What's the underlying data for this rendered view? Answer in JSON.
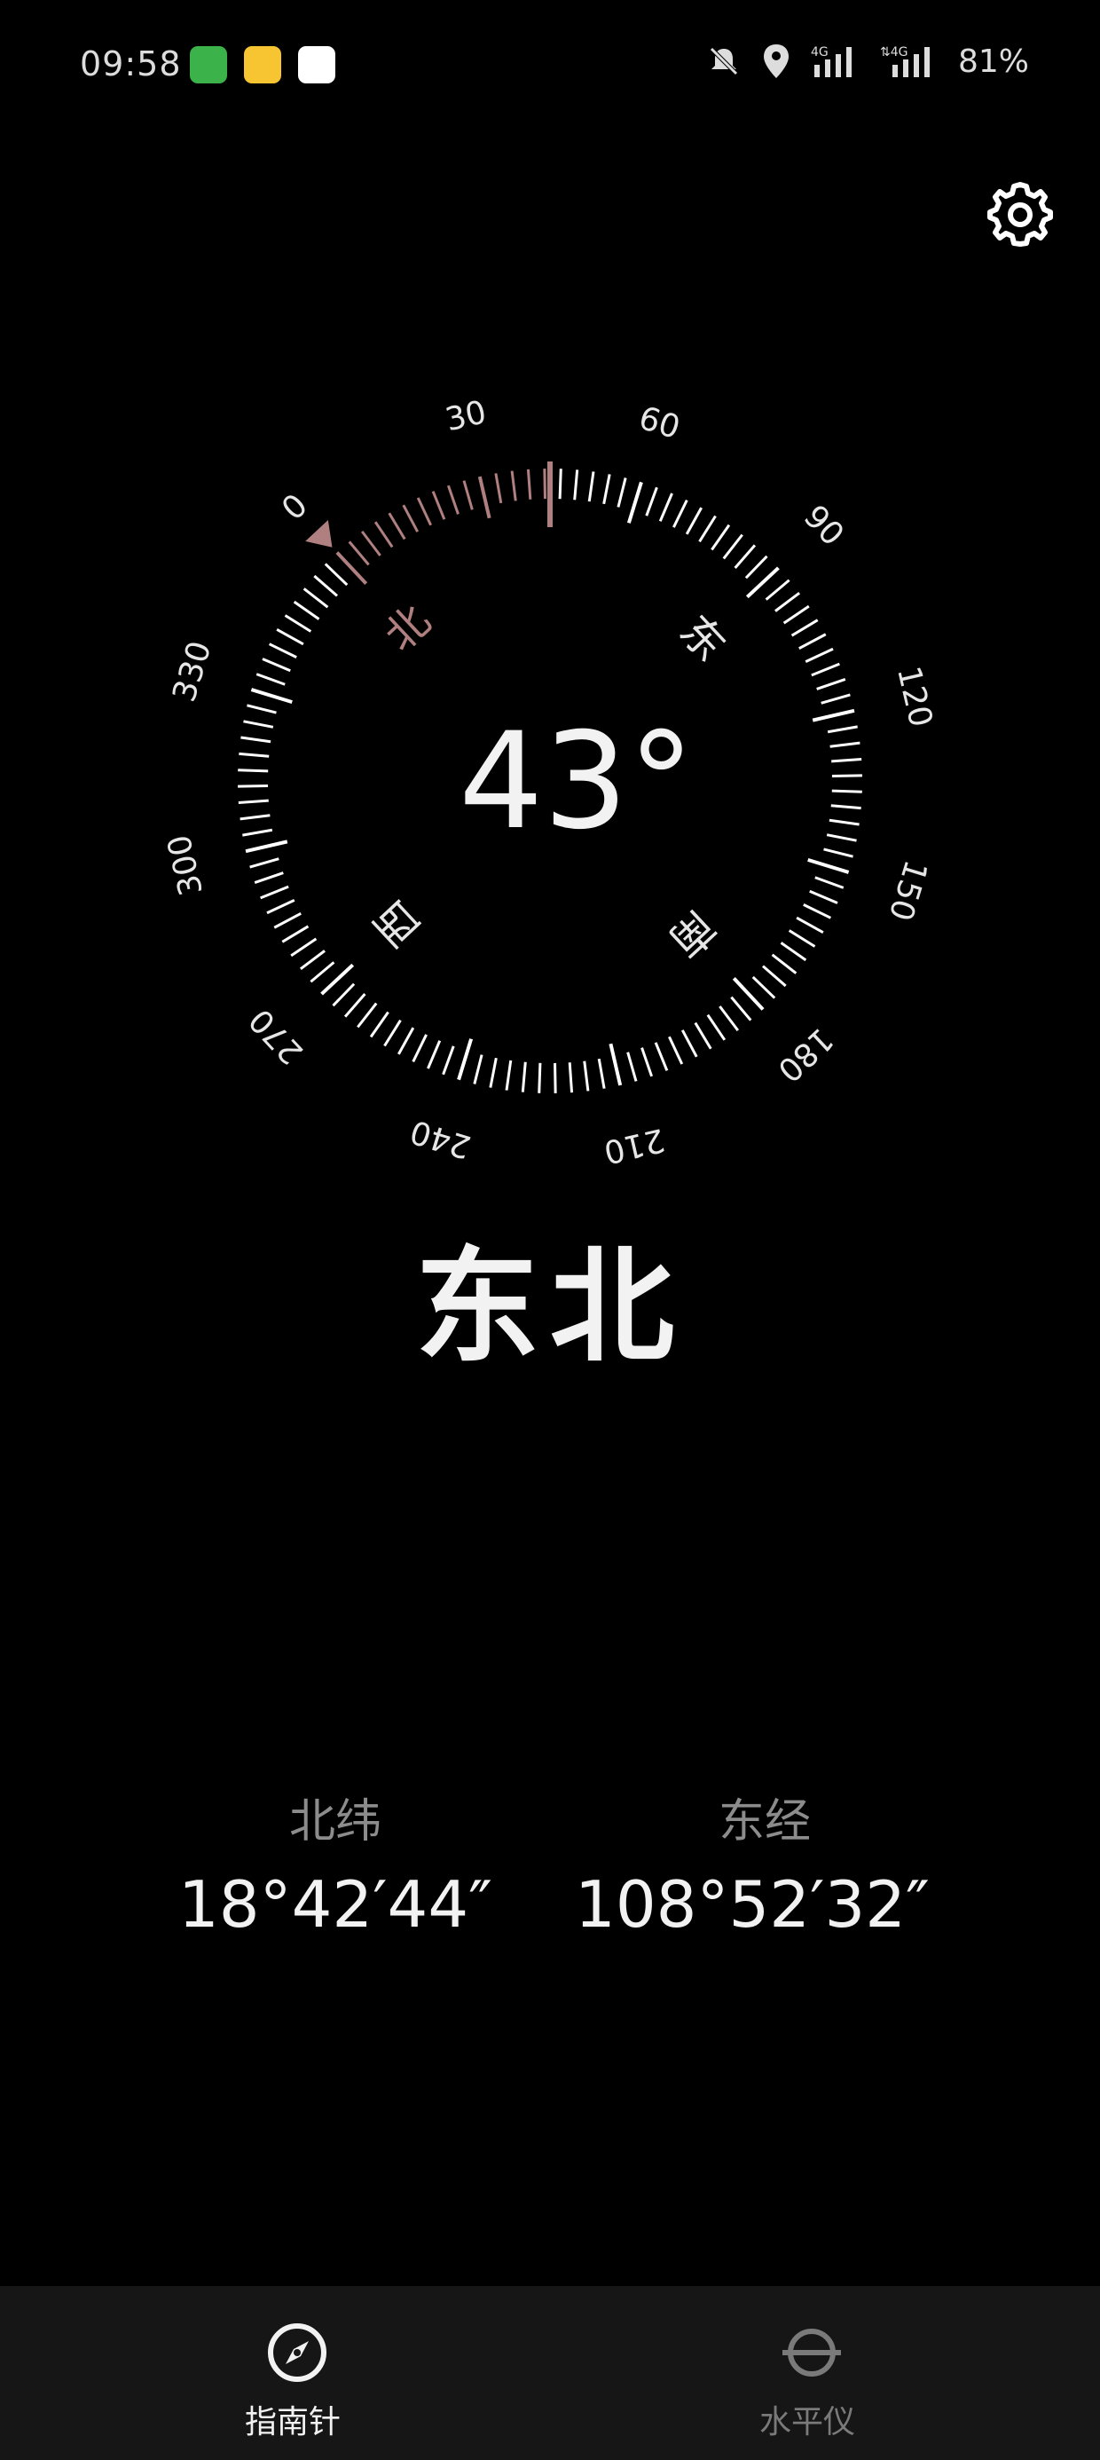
{
  "status_bar": {
    "time": "09:58",
    "apps": [
      "wechat-like-app-icon",
      "weibo-icon",
      "maps-icon"
    ],
    "icons": [
      "mute-icon",
      "location-icon",
      "signal-4g-icon",
      "signal-4g-icon"
    ],
    "battery": "81%"
  },
  "settings": {
    "icon": "gear-icon"
  },
  "compass": {
    "heading_text": "43°",
    "heading_degrees": 43,
    "degree_labels": [
      "0",
      "30",
      "60",
      "90",
      "120",
      "150",
      "180",
      "210",
      "240",
      "270",
      "300",
      "330"
    ],
    "cardinals": [
      "北",
      "东",
      "南",
      "西"
    ],
    "colors": {
      "ticks": "#ffffff",
      "north_accent": "#b08080",
      "background": "#000000"
    }
  },
  "direction": "东北",
  "coordinates": {
    "latitude_label": "北纬",
    "latitude_value": "18°42′44″",
    "longitude_label": "东经",
    "longitude_value": "108°52′32″"
  },
  "bottom_nav": {
    "items": [
      {
        "label": "指南针",
        "icon": "compass-icon",
        "active": true
      },
      {
        "label": "水平仪",
        "icon": "level-icon",
        "active": false
      }
    ]
  }
}
